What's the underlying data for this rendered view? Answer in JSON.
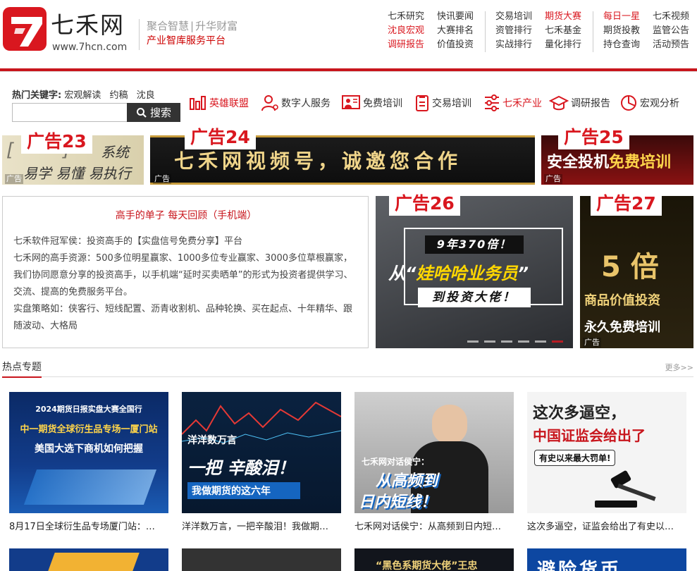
{
  "brand": {
    "name": "七禾网",
    "url": "www.7hcn.com",
    "slogan_a": "聚合智慧",
    "slogan_sep": "|",
    "slogan_b": "升华财富",
    "tagline": "产业智库服务平台"
  },
  "top_nav": {
    "col1": [
      "七禾研究",
      "沈良宏观",
      "调研报告"
    ],
    "col2": [
      "快讯要闻",
      "大赛排名",
      "价值投资"
    ],
    "col3": [
      "交易培训",
      "资管排行",
      "实战排行"
    ],
    "col4": [
      "期货大赛",
      "七禾基金",
      "量化排行"
    ],
    "col5": [
      "每日一星",
      "期货投教",
      "持仓查询"
    ],
    "col6": [
      "七禾视频",
      "监管公告",
      "活动预告"
    ]
  },
  "hot": {
    "label": "热门关键字:",
    "keywords": [
      "宏观解读",
      "约稿",
      "沈良"
    ]
  },
  "search": {
    "placeholder": "",
    "button": "搜索"
  },
  "main_nav": [
    "英雄联盟",
    "数字人服务",
    "免费培训",
    "交易培训",
    "七禾产业",
    "调研报告",
    "宏观分析"
  ],
  "ads": {
    "tag": "广告",
    "ad23": {
      "label": "广告23",
      "text": "易学 易懂 易执行",
      "text_top": "系统"
    },
    "ad24": {
      "label": "广告24",
      "text": "七禾网视频号，诚邀您合作"
    },
    "ad25": {
      "label": "广告25",
      "text_a": "安全投机",
      "text_b": "免费培训"
    },
    "ad26": {
      "label": "广告26",
      "line1": "9年370倍！",
      "line2a": "从“",
      "line2b": "娃哈哈业务员",
      "line2c": "”",
      "line3": "到投资大佬！"
    },
    "ad27": {
      "label": "广告27",
      "big": "5 倍",
      "line1": "商品价值投资",
      "line2": "永久免费培训"
    }
  },
  "panel": {
    "title": "高手的单子 每天回顾（手机端）",
    "p1": "七禾软件冠军侯：投资高手的【实盘信号免费分享】平台",
    "p2": "七禾网的高手资源：500多位明星赢家、1000多位专业赢家、3000多位草根赢家，我们协同愿意分享的投资高手，以手机端“延时买卖晒单”的形式为投资者提供学习、交流、提高的免费服务平台。",
    "p3": "实盘策略如：侠客行、短线配置、沥青收割机、品种轮换、买在起点、十年精华、跟随波动、大格局"
  },
  "topics": {
    "title": "热点专题",
    "more": "更多>>"
  },
  "cards": [
    {
      "caption": "8月17日全球衍生品专场厦门站：…",
      "t1": "2024期货日报实盘大赛全国行",
      "t2": "中一期货全球衍生品专场一厦门站",
      "t3": "美国大选下商机如何把握"
    },
    {
      "caption": "洋洋数万言，一把辛酸泪！我做期…",
      "t1": "洋洋数万言",
      "t2": "一把 辛酸泪！",
      "t3": "我做期货的这六年"
    },
    {
      "caption": "七禾网对话侯宁：从高频到日内短…",
      "t1": "七禾网对话侯宁：",
      "t2": "从高频到",
      "t3": "日内短线！"
    },
    {
      "caption": "这次多逼空，证监会给出了有史以…",
      "t1": "这次多逼空，",
      "t2": "中国证监会给出了",
      "t3": "有史以来最大罚单!"
    }
  ],
  "cards2": [
    {
      "text": ""
    },
    {
      "text": ""
    },
    {
      "text": "“黑色系期货大佬”王忠"
    },
    {
      "text": "避险货币"
    }
  ]
}
